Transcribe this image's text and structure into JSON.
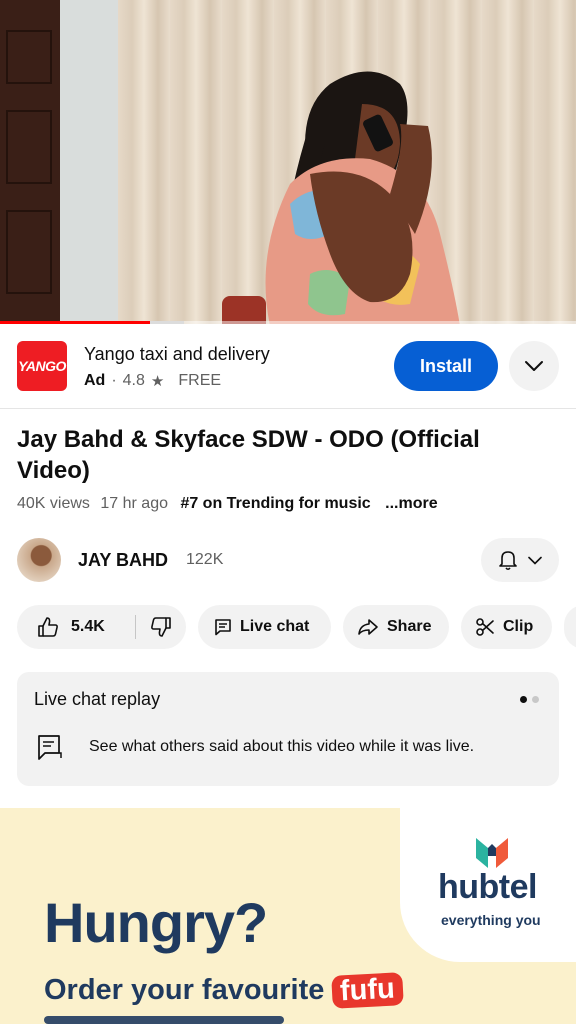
{
  "ad": {
    "logo_text": "YANGO",
    "title": "Yango taxi and delivery",
    "badge": "Ad",
    "separator": "·",
    "rating": "4.8",
    "price": "FREE",
    "install_label": "Install",
    "brand_color": "#ee1d23"
  },
  "player": {
    "progress_fraction": 0.26,
    "buffered_fraction": 0.32,
    "progress_color": "#ff0000"
  },
  "video": {
    "title": "Jay Bahd & Skyface SDW - ODO (Official Video)",
    "views": "40K views",
    "age": "17 hr ago",
    "trending": "#7 on Trending for music",
    "more": "...more"
  },
  "channel": {
    "name": "JAY BAHD",
    "subscribers": "122K"
  },
  "actions": {
    "likes": "5.4K",
    "live_chat": "Live chat",
    "share": "Share",
    "clip": "Clip"
  },
  "live_chat_replay": {
    "heading": "Live chat replay",
    "description": "See what others said about this video while it was live.",
    "page_count": 2,
    "active_page": 1
  },
  "promo": {
    "brand": "hubtel",
    "tagline": "everything you",
    "headline": "Hungry?",
    "line_text": "Order your favourite",
    "highlight": "fufu",
    "brand_color": "#1f3a5f",
    "accent_color": "#e8372c"
  },
  "icons": {
    "expand": "chevron-down-icon",
    "bell": "bell-icon",
    "like": "thumbs-up-icon",
    "dislike": "thumbs-down-icon",
    "live_chat": "chat-icon",
    "share": "share-arrow-icon",
    "clip": "scissors-icon"
  }
}
